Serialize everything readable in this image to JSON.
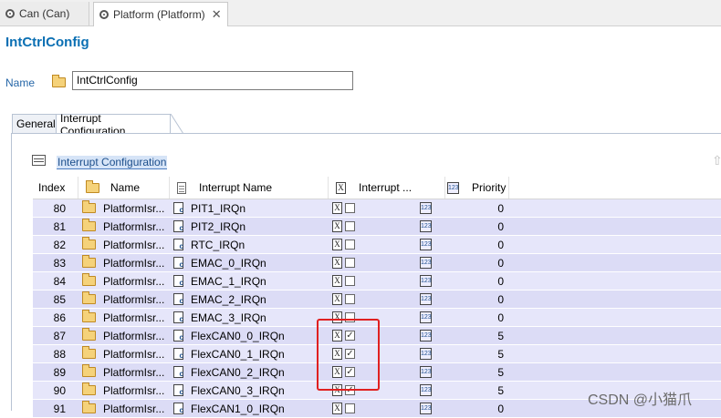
{
  "editor_tabs": [
    {
      "label": "Can (Can)",
      "active": false
    },
    {
      "label": "Platform (Platform)",
      "active": true,
      "close": "✕"
    }
  ],
  "page_title": "IntCtrlConfig",
  "name_field": {
    "label": "Name",
    "value": "IntCtrlConfig"
  },
  "config_tabs": [
    "General",
    "Interrupt Configuration"
  ],
  "section_title": "Interrupt Configuration",
  "table": {
    "headers": {
      "index": "Index",
      "name": "Name",
      "interrupt_name": "Interrupt Name",
      "enabled": "Interrupt ...",
      "priority": "Priority"
    },
    "rows": [
      {
        "index": "80",
        "name": "PlatformIsr...",
        "interrupt_name": "PIT1_IRQn",
        "checked": false,
        "check_mark": "",
        "priority": "0"
      },
      {
        "index": "81",
        "name": "PlatformIsr...",
        "interrupt_name": "PIT2_IRQn",
        "checked": false,
        "check_mark": "",
        "priority": "0"
      },
      {
        "index": "82",
        "name": "PlatformIsr...",
        "interrupt_name": "RTC_IRQn",
        "checked": false,
        "check_mark": "",
        "priority": "0"
      },
      {
        "index": "83",
        "name": "PlatformIsr...",
        "interrupt_name": "EMAC_0_IRQn",
        "checked": false,
        "check_mark": "",
        "priority": "0"
      },
      {
        "index": "84",
        "name": "PlatformIsr...",
        "interrupt_name": "EMAC_1_IRQn",
        "checked": false,
        "check_mark": "",
        "priority": "0"
      },
      {
        "index": "85",
        "name": "PlatformIsr...",
        "interrupt_name": "EMAC_2_IRQn",
        "checked": false,
        "check_mark": "",
        "priority": "0"
      },
      {
        "index": "86",
        "name": "PlatformIsr...",
        "interrupt_name": "EMAC_3_IRQn",
        "checked": false,
        "check_mark": "",
        "priority": "0"
      },
      {
        "index": "87",
        "name": "PlatformIsr...",
        "interrupt_name": "FlexCAN0_0_IRQn",
        "checked": true,
        "check_mark": "✓",
        "priority": "5"
      },
      {
        "index": "88",
        "name": "PlatformIsr...",
        "interrupt_name": "FlexCAN0_1_IRQn",
        "checked": true,
        "check_mark": "✓",
        "priority": "5"
      },
      {
        "index": "89",
        "name": "PlatformIsr...",
        "interrupt_name": "FlexCAN0_2_IRQn",
        "checked": true,
        "check_mark": "✓",
        "priority": "5"
      },
      {
        "index": "90",
        "name": "PlatformIsr...",
        "interrupt_name": "FlexCAN0_3_IRQn",
        "checked": true,
        "check_mark": "✓",
        "priority": "5"
      },
      {
        "index": "91",
        "name": "PlatformIsr...",
        "interrupt_name": "FlexCAN1_0_IRQn",
        "checked": false,
        "check_mark": "",
        "priority": "0"
      }
    ]
  },
  "icons": {
    "x_glyph": "X",
    "num_glyph": "123",
    "up_arrow": "⇧"
  },
  "watermark": "CSDN @小猫爪",
  "colors": {
    "title": "#0a6fb3",
    "row_odd": "#e6e6fa",
    "row_even": "#dcdcf6",
    "highlight": "#e02020"
  }
}
